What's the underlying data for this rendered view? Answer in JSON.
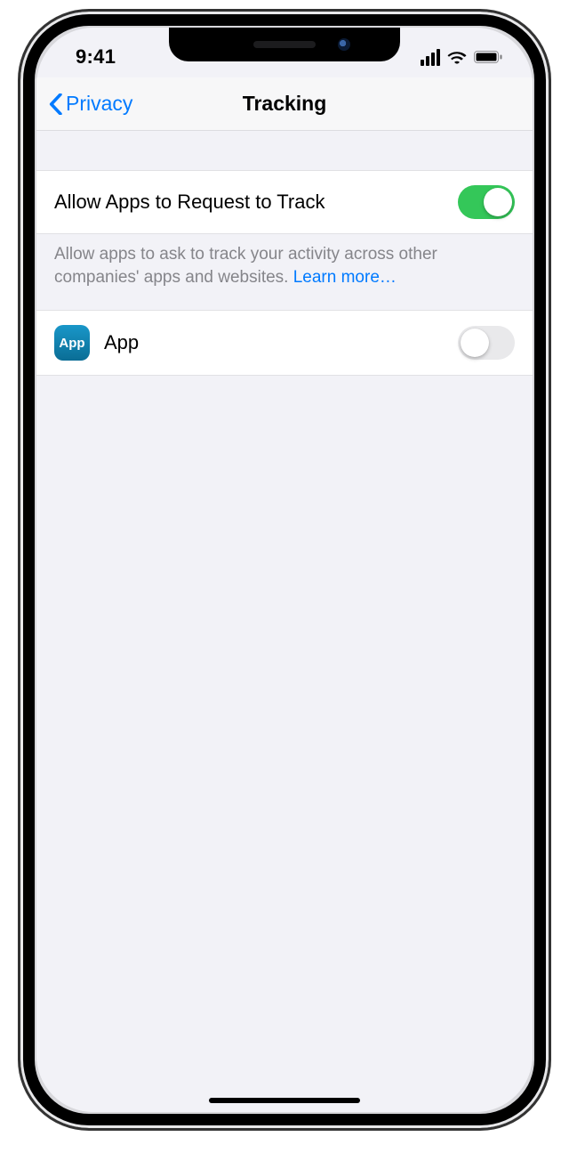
{
  "status": {
    "time": "9:41"
  },
  "nav": {
    "back_label": "Privacy",
    "title": "Tracking"
  },
  "settings": {
    "allow_label": "Allow Apps to Request to Track",
    "allow_on": true,
    "footer": "Allow apps to ask to track your activity across other companies' apps and websites. ",
    "learn_more": "Learn more…"
  },
  "apps": [
    {
      "icon_text": "App",
      "name": "App",
      "enabled": false
    }
  ]
}
